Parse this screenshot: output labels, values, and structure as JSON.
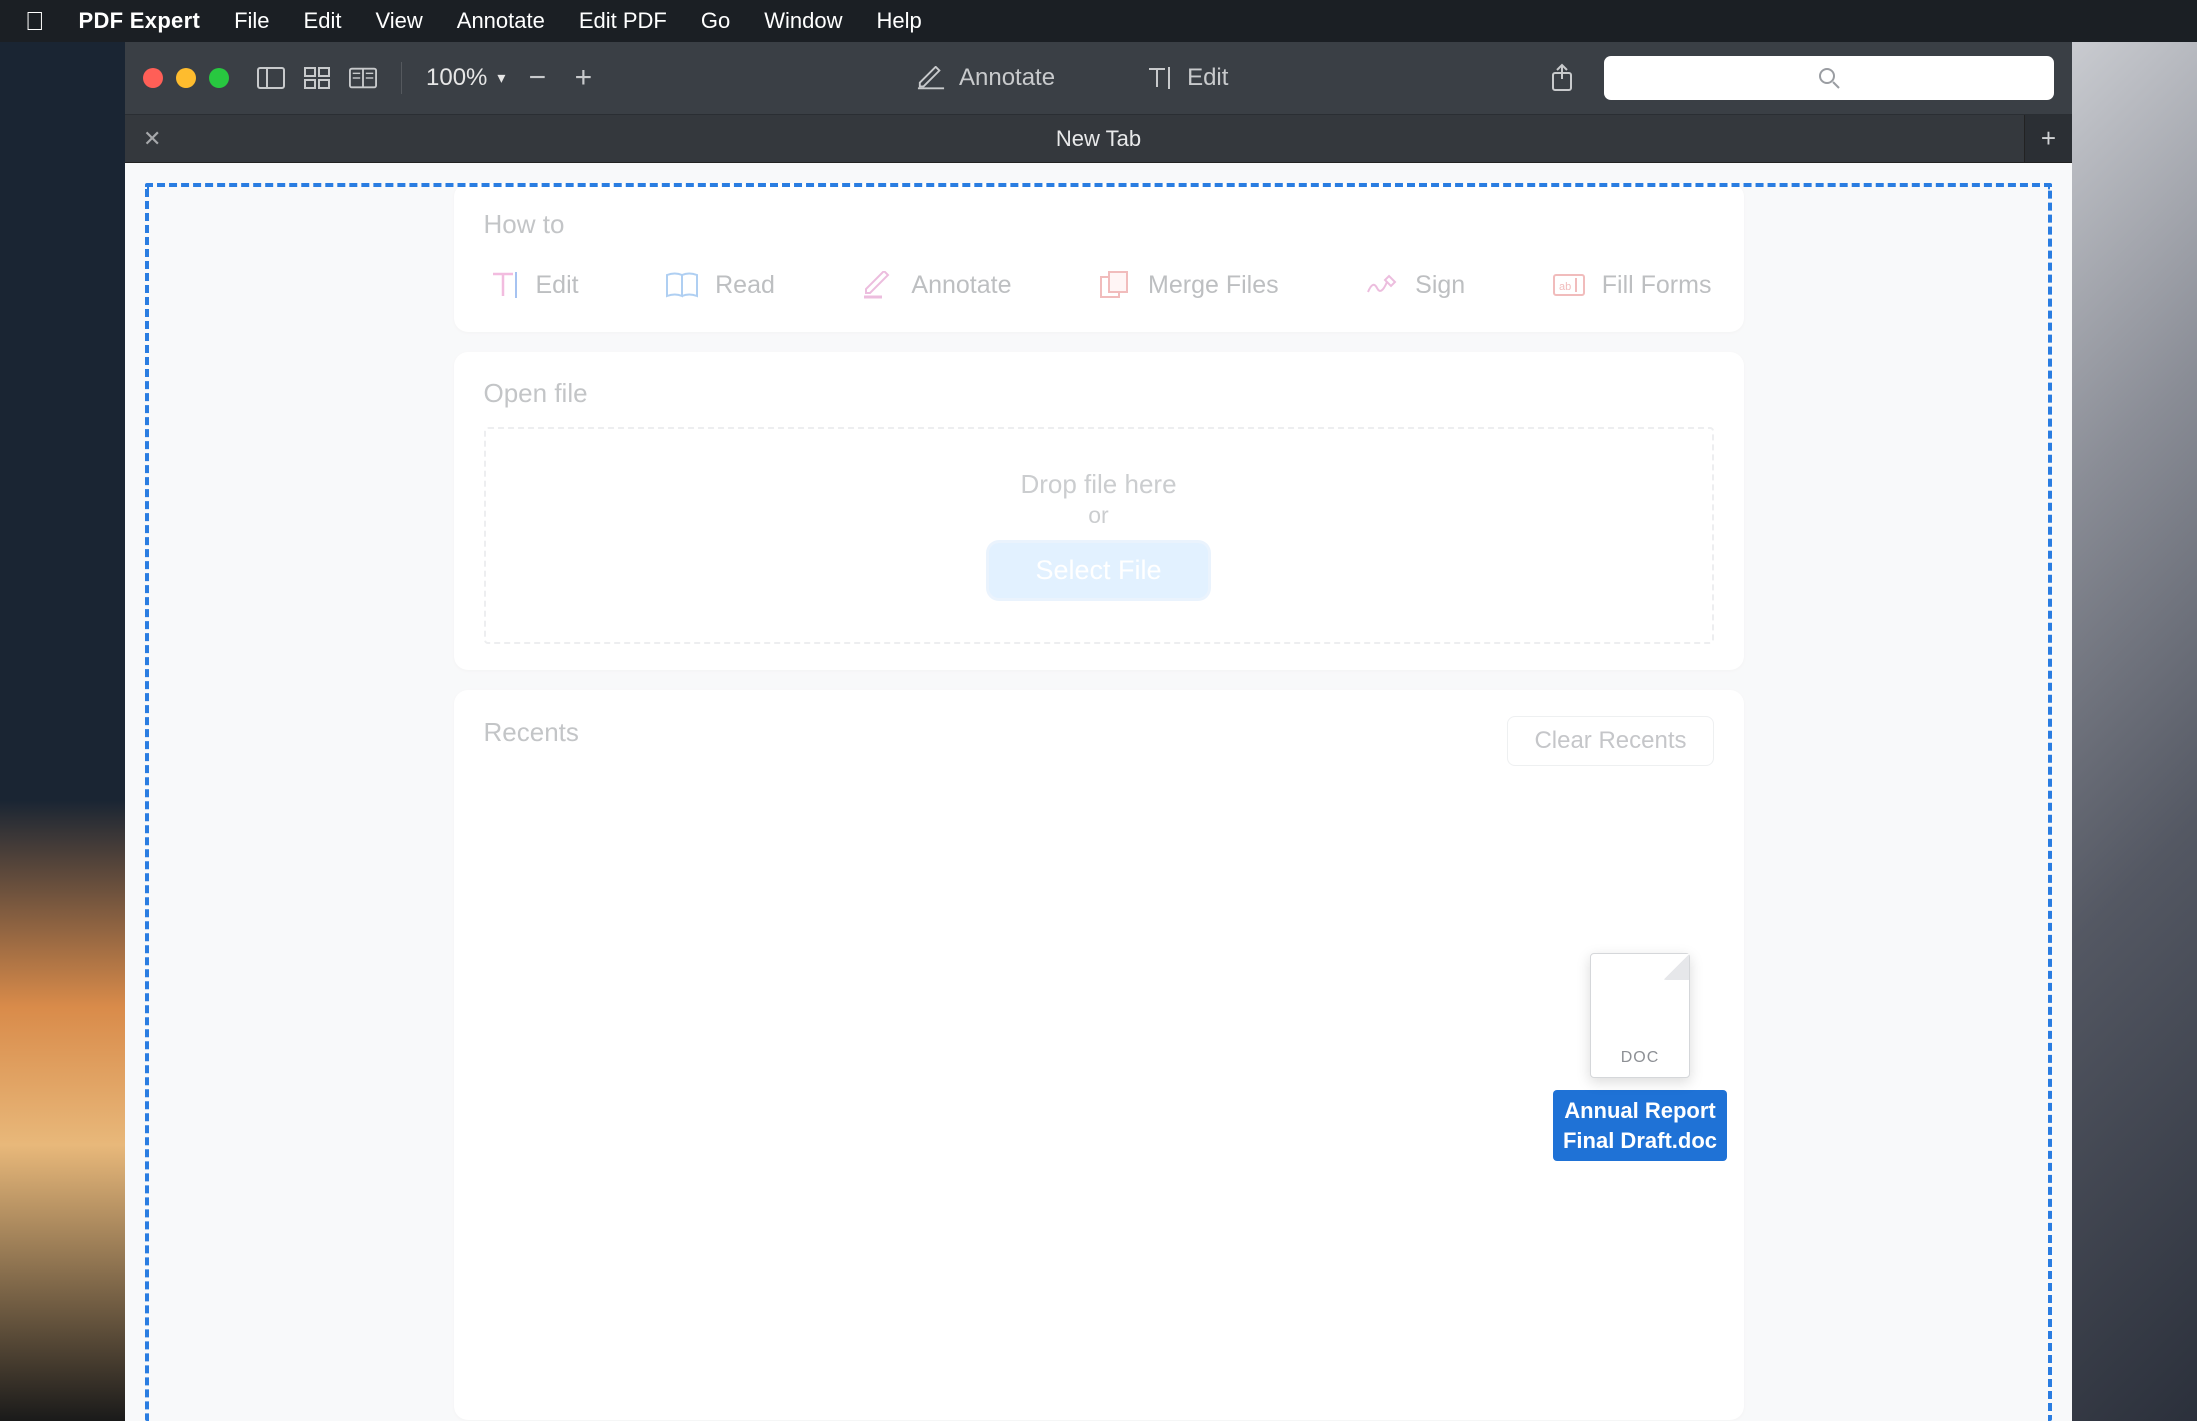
{
  "menubar": {
    "app_name": "PDF Expert",
    "items": [
      "File",
      "Edit",
      "View",
      "Annotate",
      "Edit PDF",
      "Go",
      "Window",
      "Help"
    ]
  },
  "toolbar": {
    "zoom": "100%",
    "annotate_label": "Annotate",
    "edit_label": "Edit",
    "search_placeholder": ""
  },
  "tab": {
    "title": "New Tab"
  },
  "howto": {
    "heading": "How to",
    "items": [
      {
        "label": "Edit"
      },
      {
        "label": "Read"
      },
      {
        "label": "Annotate"
      },
      {
        "label": "Merge Files"
      },
      {
        "label": "Sign"
      },
      {
        "label": "Fill Forms"
      }
    ]
  },
  "openfile": {
    "heading": "Open file",
    "drop_text": "Drop file here",
    "or_text": "or",
    "select_label": "Select File"
  },
  "recents": {
    "heading": "Recents",
    "clear_label": "Clear Recents"
  },
  "drag": {
    "ext": "DOC",
    "line1": "Annual Report",
    "line2": "Final Draft.doc"
  }
}
